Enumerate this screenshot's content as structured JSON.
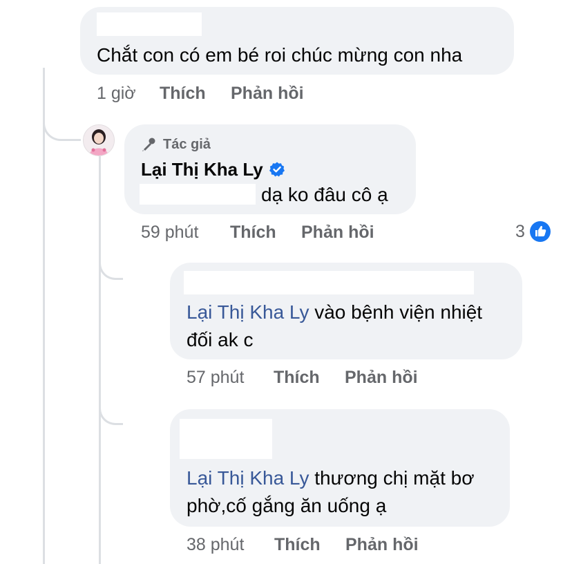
{
  "comments": [
    {
      "text": "Chắt con có em bé roi chúc mừng con nha",
      "time": "1 giờ",
      "like_label": "Thích",
      "reply_label": "Phản hồi"
    }
  ],
  "author_reply": {
    "badge_label": "Tác giả",
    "name": "Lại Thị Kha Ly",
    "text": "dạ ko đâu cô ạ",
    "time": "59 phút",
    "like_label": "Thích",
    "reply_label": "Phản hồi",
    "reaction_count": "3",
    "reaction_icon": "like-thumb-icon",
    "accent_color": "#1877f2"
  },
  "nested_replies": [
    {
      "mention": "Lại Thị Kha Ly",
      "text_line1": " vào bệnh viện nhiệt",
      "text_line2": "đối ak c",
      "time": "57 phút",
      "like_label": "Thích",
      "reply_label": "Phản hồi"
    },
    {
      "mention": "Lại Thị Kha Ly",
      "text_line1": " thương chị mặt bơ",
      "text_line2": "phờ,cố gắng ăn uống ạ",
      "time": "38 phút",
      "like_label": "Thích",
      "reply_label": "Phản hồi"
    }
  ]
}
